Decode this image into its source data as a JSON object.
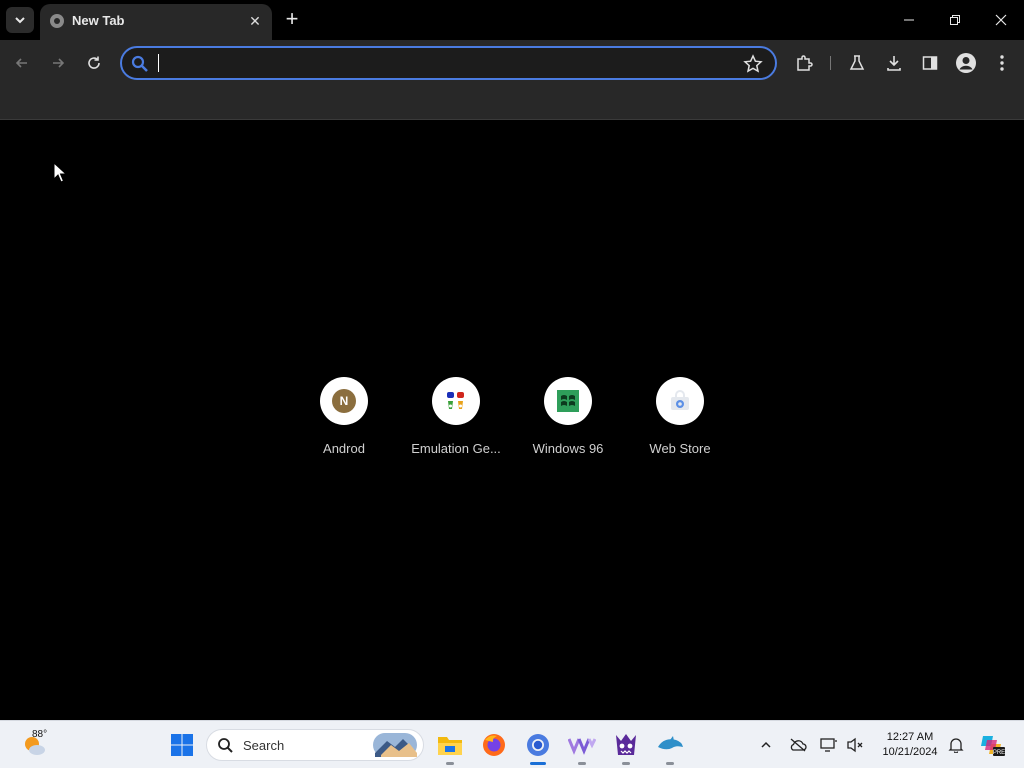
{
  "browser": {
    "tab": {
      "title": "New Tab"
    },
    "omnibox": {
      "value": "",
      "placeholder": ""
    }
  },
  "shortcuts": [
    {
      "label": "Androd",
      "letter": "N"
    },
    {
      "label": "Emulation Ge..."
    },
    {
      "label": "Windows 96"
    },
    {
      "label": "Web Store"
    }
  ],
  "taskbar": {
    "weather": {
      "temp": "88°"
    },
    "search": {
      "label": "Search"
    },
    "clock": {
      "time": "12:27 AM",
      "date": "10/21/2024"
    }
  },
  "colors": {
    "omnibox_border": "#4a7be0",
    "tab_bg": "#282828",
    "page_bg": "#000000",
    "taskbar_bg": "#eef1f6",
    "accent": "#1a6fd6"
  }
}
